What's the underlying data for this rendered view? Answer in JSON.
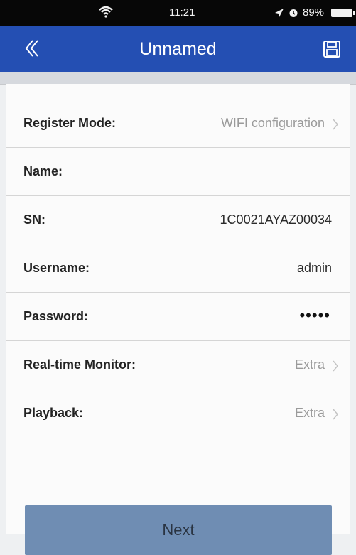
{
  "status_bar": {
    "time": "11:21",
    "battery": "89%",
    "icons": [
      "wifi-icon",
      "location-arrow-icon",
      "alarm-icon",
      "battery-icon"
    ]
  },
  "nav": {
    "title": "Unnamed",
    "back_icon": "back-chevron-icon",
    "save_icon": "save-icon"
  },
  "form": {
    "rows": [
      {
        "label": "Register Mode:",
        "value": "WIFI configuration",
        "chevron": true
      },
      {
        "label": "Name:",
        "value": ""
      },
      {
        "label": "SN:",
        "value": "1C0021AYAZ00034"
      },
      {
        "label": "Username:",
        "value": "admin"
      },
      {
        "label": "Password:",
        "value": "•••••"
      },
      {
        "label": "Real-time Monitor:",
        "value": "Extra",
        "chevron": true
      },
      {
        "label": "Playback:",
        "value": "Extra",
        "chevron": true
      }
    ]
  },
  "next_label": "Next",
  "colors": {
    "nav_bar": "#244fb3",
    "next_button": "#6f8db3",
    "background": "#eef0f2"
  }
}
